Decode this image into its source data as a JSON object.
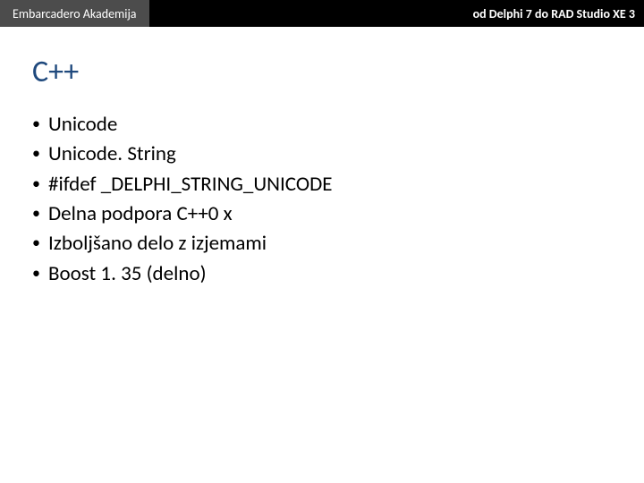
{
  "header": {
    "left": "Embarcadero Akademija",
    "right": "od Delphi 7 do RAD Studio XE 3"
  },
  "title": "C++",
  "bullets": [
    "Unicode",
    "Unicode. String",
    "#ifdef _DELPHI_STRING_UNICODE",
    "Delna podpora C++0 x",
    "Izboljšano delo z izjemami",
    "Boost 1. 35 (delno)"
  ]
}
